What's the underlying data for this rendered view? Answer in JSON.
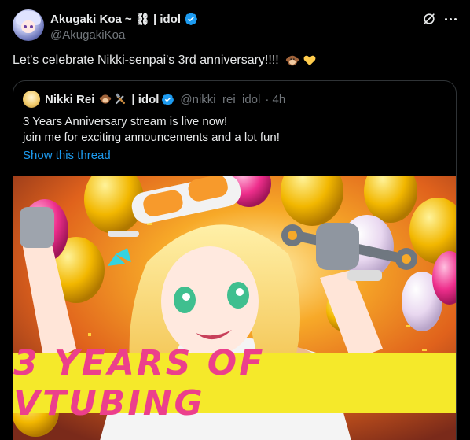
{
  "author": {
    "name": "Akugaki Koa",
    "name_decor": "~ ⛓ | idol",
    "handle": "@AkugakiKoa"
  },
  "tweet": {
    "text": "Let's celebrate Nikki-senpai's 3rd anniversary!!!!",
    "emojis": [
      "monkey-emoji",
      "yellow-heart-emoji"
    ]
  },
  "quoted": {
    "name": "Nikki Rei",
    "name_suffix": "| idol",
    "handle": "@nikki_rei_idol",
    "time": "· 4h",
    "line1": "3 Years Anniversary stream is live now!",
    "line2": "join me for exciting announcements and a lot fun!",
    "thread_link": "Show this thread",
    "image": {
      "banner_text": "3 YEARS OF VTUBING"
    }
  },
  "colors": {
    "background": "#000000",
    "text": "#e7e9ea",
    "muted": "#71767b",
    "link": "#1d9bf0",
    "border": "#2f3336",
    "banner_bg": "#f5e92a",
    "banner_text": "#ec3f8c"
  },
  "icons": [
    "verified-icon",
    "grok-link-icon",
    "more-icon"
  ]
}
